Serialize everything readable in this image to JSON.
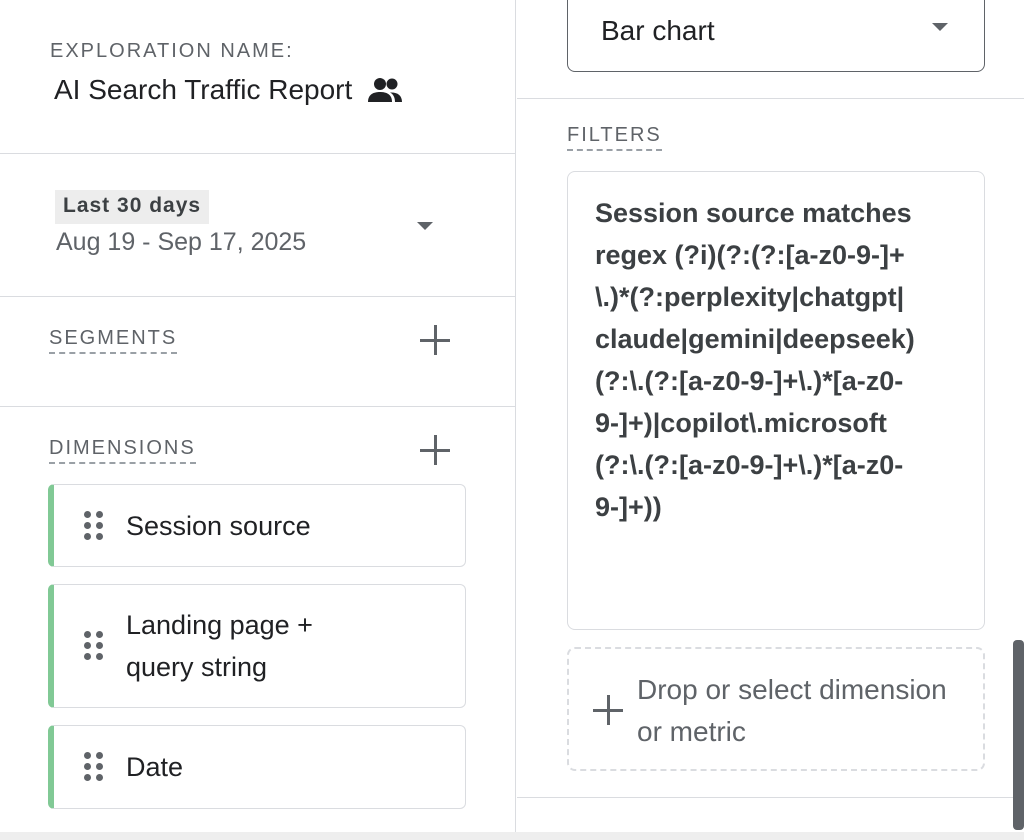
{
  "exploration": {
    "name_label": "EXPLORATION NAME:",
    "name": "AI Search Traffic Report",
    "shared_icon": "people-icon"
  },
  "date": {
    "chip": "Last 30 days",
    "range": "Aug 19 - Sep 17, 2025"
  },
  "segments": {
    "label": "SEGMENTS"
  },
  "dimensions": {
    "label": "DIMENSIONS",
    "items": [
      {
        "label": "Session source"
      },
      {
        "label": "Landing page + query string"
      },
      {
        "label": "Date"
      }
    ]
  },
  "visualization": {
    "selected": "Bar chart"
  },
  "filters": {
    "label": "FILTERS",
    "items": [
      {
        "text": "Session source matches regex (?i)(?:(?:[a-z0-9-]+\\.)*(?:perplexity|chatgpt|claude|gemini|deepseek)(?:\\.(?:[a-z0-9-]+\\.)*[a-z0-9-]+)|copilot\\.microsoft(?:\\.(?:[a-z0-9-]+\\.)*[a-z0-9-]+))"
      }
    ],
    "drop_placeholder": "Drop or select dimension or metric"
  },
  "colors": {
    "dimension_accent": "#81c995",
    "text_primary": "#202124",
    "text_secondary": "#5f6368",
    "border": "#dadce0"
  }
}
